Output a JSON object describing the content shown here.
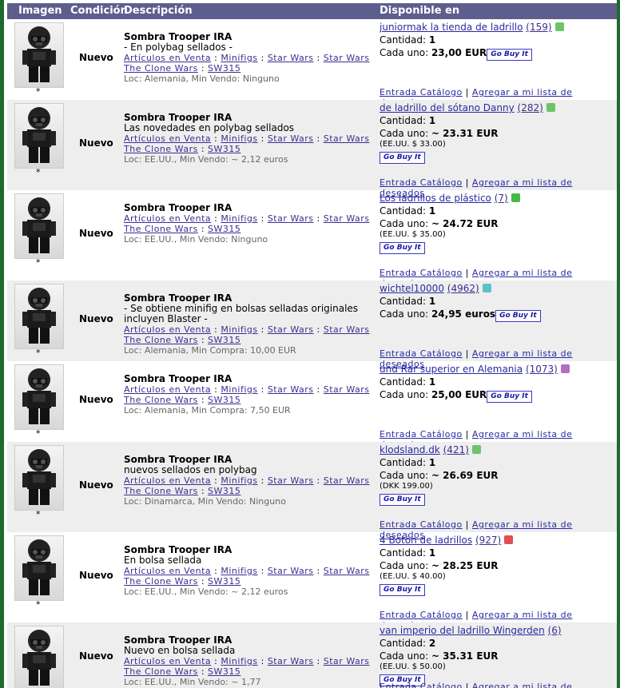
{
  "header": {
    "image": "Imagen",
    "condition": "Condición",
    "description": "Descripción",
    "available": "Disponible en"
  },
  "common": {
    "title": "Sombra Trooper IRA",
    "cat1": "Artículos en Venta",
    "cat2": "Minifigs",
    "cat3": "Star Wars",
    "cat4": "Star Wars",
    "cat5": "The Clone Wars",
    "code": "SW315",
    "qty_label": "Cantidad:",
    "each_label": "Cada uno:",
    "buy_label": "Go Buy It",
    "catalog_link": "Entrada Catálogo",
    "wishlist_link": "Agregar a mi lista de deseados",
    "star": "*",
    "separator": "|",
    "colon": ":"
  },
  "rows": [
    {
      "condition": "Nuevo",
      "note": "- En polybag sellados -",
      "loc": "Loc: Alemania, Min Vendo: Ninguno",
      "store": "juniormak la tienda de ladrillo",
      "feedback": "(159)",
      "qty": "1",
      "price": "23,00 EUR",
      "conv": "",
      "badge_color": "#6cc46a"
    },
    {
      "condition": "Nuevo",
      "note": "Las novedades en polybag sellados",
      "loc": "Loc: EE.UU., Min Vendo: ~ 2,12 euros",
      "store": "de ladrillo del sótano Danny",
      "feedback": "(282)",
      "qty": "1",
      "price": "~ 23.31 EUR",
      "conv": "(EE.UU. $ 33.00)",
      "badge_color": "#6cc46a"
    },
    {
      "condition": "Nuevo",
      "note": "",
      "loc": "Loc: EE.UU., Min Vendo: Ninguno",
      "store": "Los ladrillos de plástico",
      "feedback": "(7)",
      "qty": "1",
      "price": "~ 24.72 EUR",
      "conv": "(EE.UU. $ 35.00)",
      "badge_color": "#44bb44"
    },
    {
      "condition": "Nuevo",
      "note": "- Se obtiene minifig en bolsas selladas originales incluyen Blaster -",
      "loc": "Loc: Alemania, Min Compra: 10,00 EUR",
      "store": "wichtel10000",
      "feedback": "(4962)",
      "qty": "1",
      "price": "24,95 euros",
      "conv": "",
      "badge_color": "#5cc0c8"
    },
    {
      "condition": "Nuevo",
      "note": "",
      "loc": "Loc: Alemania, Min Compra: 7,50 EUR",
      "store": "und Rar superior en Alemania",
      "feedback": "(1073)",
      "qty": "1",
      "price": "25,00 EUR",
      "conv": "",
      "badge_color": "#b070c0"
    },
    {
      "condition": "Nuevo",
      "note": "nuevos sellados en polybag",
      "loc": "Loc: Dinamarca, Min Vendo: Ninguno",
      "store": "klodsland.dk",
      "feedback": "(421)",
      "qty": "1",
      "price": "~ 26.69 EUR",
      "conv": "(DKK 199.00)",
      "badge_color": "#6cc46a"
    },
    {
      "condition": "Nuevo",
      "note": "En bolsa sellada",
      "loc": "Loc: EE.UU., Min Vendo: ~ 2,12 euros",
      "store": "4 Botón de ladrillos",
      "feedback": "(927)",
      "qty": "1",
      "price": "~ 28.25 EUR",
      "conv": "(EE.UU. $ 40.00)",
      "badge_color": "#e05050"
    },
    {
      "condition": "Nuevo",
      "note": "Nuevo en bolsa sellada",
      "loc": "Loc: EE.UU., Min Vendo: ~ 1,77",
      "store": "van imperio del ladrillo Wingerden",
      "feedback": "(6)",
      "qty": "2",
      "price": "~ 35.31 EUR",
      "conv": "(EE.UU. $ 50.00)",
      "badge_color": ""
    }
  ]
}
